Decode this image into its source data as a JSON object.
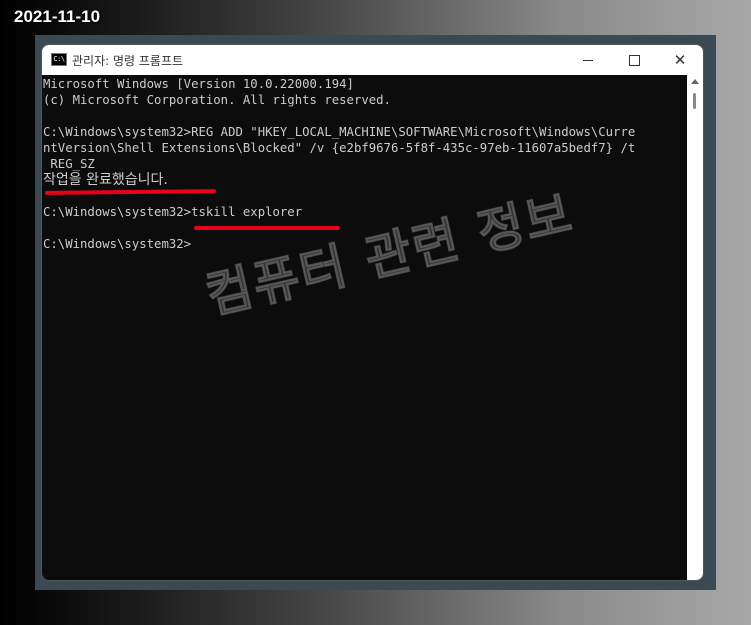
{
  "date_stamp": "2021-11-10",
  "window": {
    "title": "관리자: 명령 프롬프트",
    "icon": "cmd-icon",
    "icon_label": "C:\\",
    "minimize": "minimize-icon",
    "maximize": "maximize-icon",
    "close_label": "✕"
  },
  "console": {
    "lines": [
      "Microsoft Windows [Version 10.0.22000.194]",
      "(c) Microsoft Corporation. All rights reserved.",
      "",
      "C:\\Windows\\system32>REG ADD \"HKEY_LOCAL_MACHINE\\SOFTWARE\\Microsoft\\Windows\\Curre",
      "ntVersion\\Shell Extensions\\Blocked\" /v {e2bf9676-5f8f-435c-97eb-11607a5bedf7} /t",
      " REG_SZ",
      "작업을 완료했습니다.",
      "",
      "C:\\Windows\\system32>tskill explorer",
      "",
      "C:\\Windows\\system32>"
    ]
  },
  "watermark": "컴퓨터 관련 정보",
  "colors": {
    "highlight": "#e8001a",
    "console_bg": "#0c0c0c",
    "console_fg": "#cccccc"
  }
}
